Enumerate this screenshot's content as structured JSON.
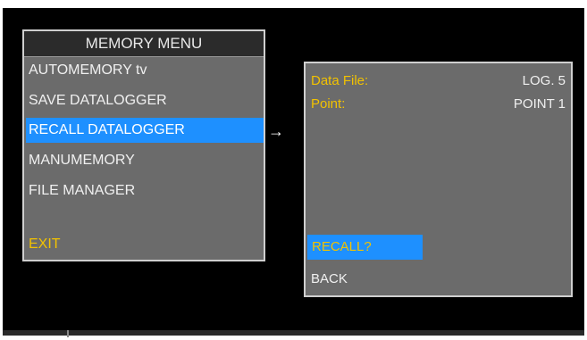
{
  "memory_menu": {
    "title": "MEMORY MENU",
    "items": [
      {
        "label": "AUTOMEMORY tv"
      },
      {
        "label": "SAVE DATALOGGER"
      },
      {
        "label": "RECALL DATALOGGER"
      },
      {
        "label": "MANUMEMORY"
      },
      {
        "label": "FILE MANAGER"
      }
    ],
    "selected_item": "RECALL DATALOGGER",
    "exit_label": "EXIT"
  },
  "arrow": "→",
  "detail_panel": {
    "data_file_label": "Data File:",
    "data_file_value": "LOG. 5",
    "point_label": "Point:",
    "point_value": "POINT 1",
    "recall_label": "RECALL?",
    "back_label": "BACK"
  },
  "colors": {
    "panel_bg": "#6b6b6b",
    "highlight": "#1e90ff",
    "label_yellow": "#f2c200",
    "screen_bg": "#000000"
  }
}
